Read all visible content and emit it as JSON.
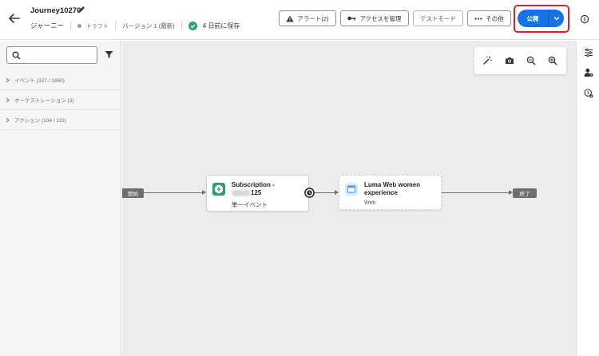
{
  "header": {
    "title": "Journey10270",
    "type_label": "ジャーニー",
    "status": "ドラフト",
    "version": "バージョン 1 (最新)",
    "saved": "4 日前に保存",
    "buttons": {
      "alerts": "アラート(2)",
      "access": "アクセスを管理",
      "test_mode": "テストモード",
      "more": "その他",
      "publish": "公開"
    }
  },
  "left_panel": {
    "search_placeholder": "",
    "categories": [
      {
        "label": "イベント (327 / 1860)"
      },
      {
        "label": "オーケストレーション (3)"
      },
      {
        "label": "アクション (104 / 113)"
      }
    ]
  },
  "canvas": {
    "start_label": "開始",
    "end_label": "終了",
    "nodes": [
      {
        "title_line1": "Subscription -",
        "title_line2": "125",
        "subtitle": "単一イベント"
      },
      {
        "title_line1": "Luma Web women",
        "title_line2": "experience",
        "subtitle": "Web"
      }
    ]
  },
  "colors": {
    "accent": "#1473e6",
    "highlight": "#d9232a",
    "success": "#2d9d78",
    "event_icon": "#2d9d78",
    "web_icon": "#4b9cf5"
  }
}
